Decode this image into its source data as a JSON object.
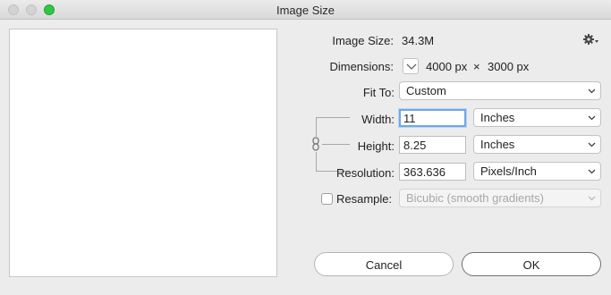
{
  "window": {
    "title": "Image Size"
  },
  "info": {
    "image_size_label": "Image Size:",
    "image_size_value": "34.3M",
    "dimensions_label": "Dimensions:",
    "dim_width": "4000 px",
    "dim_times": "×",
    "dim_height": "3000 px"
  },
  "fit_to": {
    "label": "Fit To:",
    "value": "Custom"
  },
  "width": {
    "label": "Width:",
    "value": "11",
    "unit": "Inches"
  },
  "height": {
    "label": "Height:",
    "value": "8.25",
    "unit": "Inches"
  },
  "resolution": {
    "label": "Resolution:",
    "value": "363.636",
    "unit": "Pixels/Inch"
  },
  "resample": {
    "label": "Resample:",
    "checked": false,
    "method": "Bicubic (smooth gradients)"
  },
  "buttons": {
    "cancel": "Cancel",
    "ok": "OK"
  },
  "icons": {
    "settings": "gear-icon",
    "constrain": "chain-link-icon",
    "dimensions_toggle": "chevron-down-icon"
  },
  "colors": {
    "focus_ring": "#6fa8e6",
    "maximize": "#2ec846"
  }
}
